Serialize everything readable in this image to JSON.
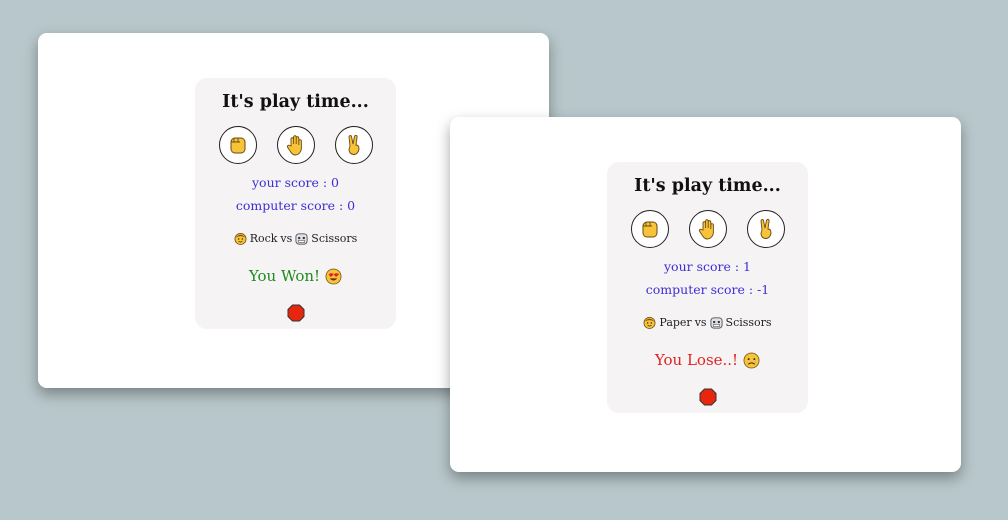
{
  "screens": [
    {
      "title": "It's play time...",
      "choices": [
        {
          "name": "rock",
          "icon": "fist-hand-icon"
        },
        {
          "name": "paper",
          "icon": "raised-hand-icon"
        },
        {
          "name": "scissors",
          "icon": "victory-hand-icon"
        }
      ],
      "your_score": "your score : 0",
      "computer_score": "computer score : 0",
      "matchup": {
        "player_choice": "Rock",
        "vs": "vs",
        "computer_choice": "Scissors"
      },
      "result": "You Won!",
      "result_icon": "heart-eyes-face-icon",
      "result_color": "#1f8a1f"
    },
    {
      "title": "It's play time...",
      "choices": [
        {
          "name": "rock",
          "icon": "fist-hand-icon"
        },
        {
          "name": "paper",
          "icon": "raised-hand-icon"
        },
        {
          "name": "scissors",
          "icon": "victory-hand-icon"
        }
      ],
      "your_score": "your score : 1",
      "computer_score": "computer score : -1",
      "matchup": {
        "player_choice": "Paper",
        "vs": "vs",
        "computer_choice": "Scissors"
      },
      "result": "You Lose..!",
      "result_icon": "sad-face-icon",
      "result_color": "#e02222"
    }
  ],
  "colors": {
    "background": "#b8c7cb",
    "panel": "#f6f3f4",
    "score_text": "#3a2fd6",
    "stop_button": "#e8260e"
  }
}
